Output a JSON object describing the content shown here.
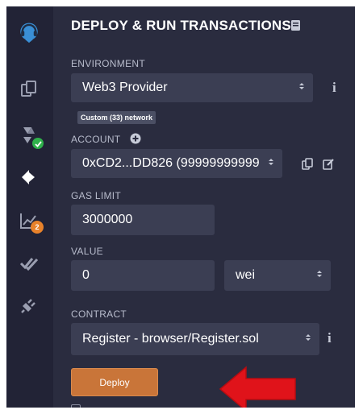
{
  "panel": {
    "title": "DEPLOY & RUN TRANSACTIONS",
    "title_icon": "book-icon"
  },
  "environment": {
    "label": "ENVIRONMENT",
    "value": "Web3 Provider",
    "network_tag": "Custom (33) network"
  },
  "account": {
    "label": "ACCOUNT",
    "value": "0xCD2...DD826 (99999999999"
  },
  "gas_limit": {
    "label": "GAS LIMIT",
    "value": "3000000"
  },
  "value_field": {
    "label": "VALUE",
    "amount": "0",
    "unit": "wei"
  },
  "contract": {
    "label": "CONTRACT",
    "value": "Register - browser/Register.sol"
  },
  "deploy": {
    "label": "Deploy"
  },
  "sidebar": {
    "items": [
      {
        "icon": "remix-logo-icon"
      },
      {
        "icon": "file-explorer-icon"
      },
      {
        "icon": "solidity-compiler-icon"
      },
      {
        "icon": "deploy-run-icon"
      },
      {
        "icon": "analysis-icon",
        "badge": "2"
      },
      {
        "icon": "verify-check-icon"
      },
      {
        "icon": "plugin-icon"
      }
    ]
  },
  "colors": {
    "background": "#2a2c3f",
    "sidebar": "#222336",
    "field": "#3b3e53",
    "deploy_button": "#c97539",
    "annotation_arrow": "#e0131a",
    "badge_green": "#2fb14b",
    "badge_orange": "#e8822b"
  }
}
